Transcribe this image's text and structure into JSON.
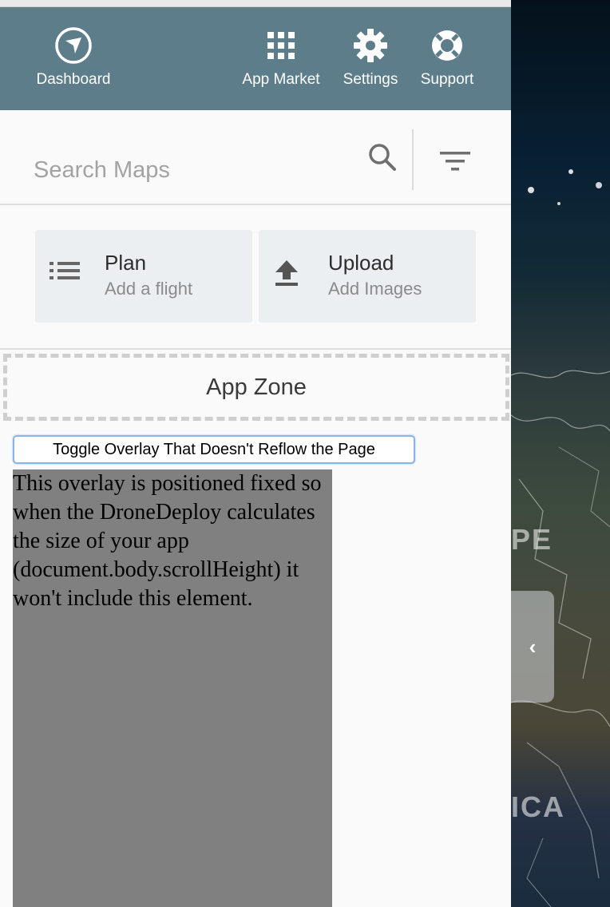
{
  "nav": {
    "items": [
      {
        "label": "Dashboard",
        "icon": "dashboard-icon"
      },
      {
        "label": "App Market",
        "icon": "apps-grid-icon"
      },
      {
        "label": "Settings",
        "icon": "gear-icon"
      },
      {
        "label": "Support",
        "icon": "lifebuoy-icon"
      }
    ],
    "bg_color": "#5e7d8b"
  },
  "search": {
    "placeholder": "Search Maps",
    "value": ""
  },
  "actions": {
    "plan": {
      "title": "Plan",
      "subtitle": "Add a flight",
      "icon": "list-icon"
    },
    "upload": {
      "title": "Upload",
      "subtitle": "Add Images",
      "icon": "upload-icon"
    }
  },
  "app_zone": {
    "label": "App Zone"
  },
  "toggle_button": {
    "label": "Toggle Overlay That Doesn't Reflow the Page"
  },
  "overlay": {
    "text": "This overlay is positioned fixed so when the DroneDeploy calculates the size of your app (document.body.scrollHeight) it won't include this element."
  },
  "map": {
    "labels": [
      "PE",
      "ICA"
    ],
    "collapse_glyph": "‹"
  }
}
